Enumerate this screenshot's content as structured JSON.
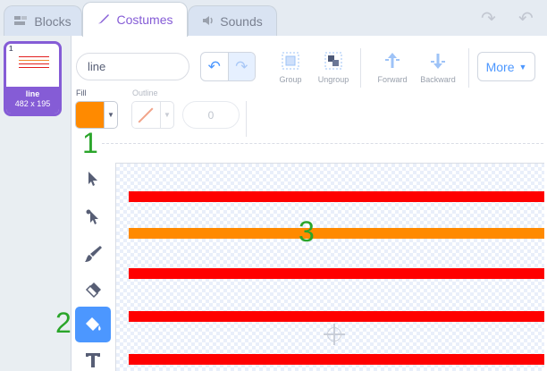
{
  "tabs": [
    {
      "label": "Blocks",
      "icon": "blocks-icon"
    },
    {
      "label": "Costumes",
      "icon": "brush-icon"
    },
    {
      "label": "Sounds",
      "icon": "speaker-icon"
    }
  ],
  "costume": {
    "number": "1",
    "name": "line",
    "size": "482 x 195"
  },
  "editor": {
    "costume_name_value": "line",
    "buttons": {
      "group": "Group",
      "ungroup": "Ungroup",
      "forward": "Forward",
      "backward": "Backward",
      "more": "More"
    },
    "fill_label": "Fill",
    "outline_label": "Outline",
    "outline_width_value": "0",
    "fill_color": "#ff8a00"
  },
  "annotations": {
    "a1": "1",
    "a2": "2",
    "a3": "3"
  },
  "canvas": {
    "stripes": [
      {
        "color": "#ff0000"
      },
      {
        "color": "#ff8a00"
      },
      {
        "color": "#ff0000"
      },
      {
        "color": "#ff0000"
      },
      {
        "color": "#ff0000"
      }
    ]
  },
  "colors": {
    "accent": "#855cd6",
    "primary": "#4c97ff",
    "annotation": "#2aa52a"
  }
}
